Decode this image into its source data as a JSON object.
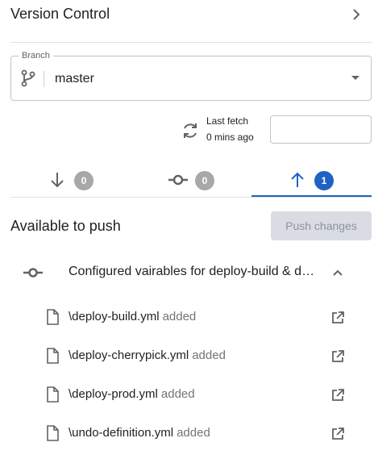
{
  "header": {
    "title": "Version Control",
    "chevron_icon": "chevron-right-icon"
  },
  "branch": {
    "legend": "Branch",
    "value": "master",
    "icon": "git-branch-icon",
    "caret_icon": "dropdown-caret-icon"
  },
  "fetch": {
    "label": "Last fetch",
    "time": "0 mins ago",
    "icon": "refresh-icon",
    "input_value": ""
  },
  "tabs": [
    {
      "name": "incoming",
      "icon": "arrow-down-icon",
      "count": "0",
      "active": false
    },
    {
      "name": "commits",
      "icon": "commit-icon",
      "count": "0",
      "active": false
    },
    {
      "name": "outgoing",
      "icon": "arrow-up-icon",
      "count": "1",
      "active": true
    }
  ],
  "push": {
    "title": "Available to push",
    "button_label": "Push changes",
    "button_enabled": false
  },
  "commit": {
    "message": "Configured vairables for deploy-build & deploy-cherrypick",
    "icon": "commit-icon",
    "expanded": true,
    "chevron_icon": "chevron-up-icon"
  },
  "files": [
    {
      "name": "\\deploy-build.yml",
      "status": "added"
    },
    {
      "name": "\\deploy-cherrypick.yml",
      "status": "added"
    },
    {
      "name": "\\deploy-prod.yml",
      "status": "added"
    },
    {
      "name": "\\undo-definition.yml",
      "status": "added"
    }
  ],
  "colors": {
    "accent": "#1e63c3",
    "badge_inactive": "#a8a8a8",
    "button_disabled_bg": "#d9dde3",
    "text_muted": "#70757a"
  }
}
